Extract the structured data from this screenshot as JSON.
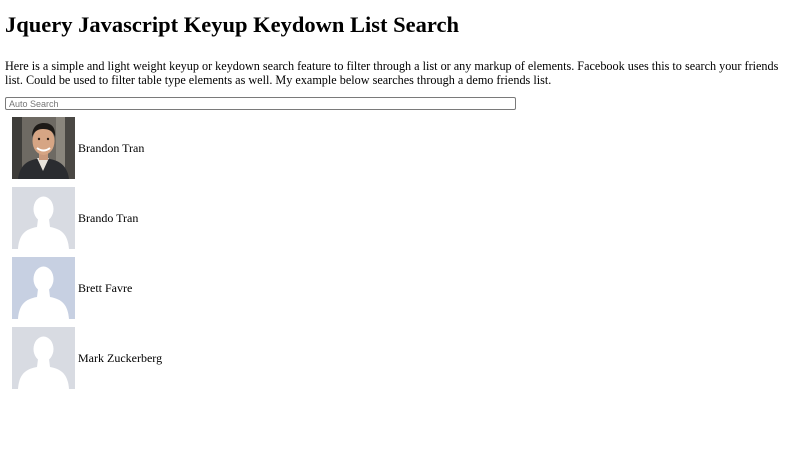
{
  "page": {
    "title": "Jquery Javascript Keyup Keydown List Search",
    "intro": "Here is a simple and light weight keyup or keydown search feature to filter through a list or any markup of elements. Facebook uses this to search your friends list. Could be used to filter table type elements as well. My example below searches through a demo friends list."
  },
  "search": {
    "placeholder": "Auto Search",
    "value": ""
  },
  "friends": [
    {
      "name": "Brandon Tran",
      "avatar": "photo"
    },
    {
      "name": "Brando Tran",
      "avatar": "default-silhouette"
    },
    {
      "name": "Brett Favre",
      "avatar": "default-silhouette-blue"
    },
    {
      "name": "Mark Zuckerberg",
      "avatar": "default-silhouette"
    }
  ],
  "colors": {
    "avatar_default_bg": "#d8dbe2",
    "avatar_default_fg": "#ffffff",
    "avatar_blue_bg": "#c7d0e2",
    "photo_bg": "#6e6a63",
    "photo_suit": "#2a2c30"
  }
}
